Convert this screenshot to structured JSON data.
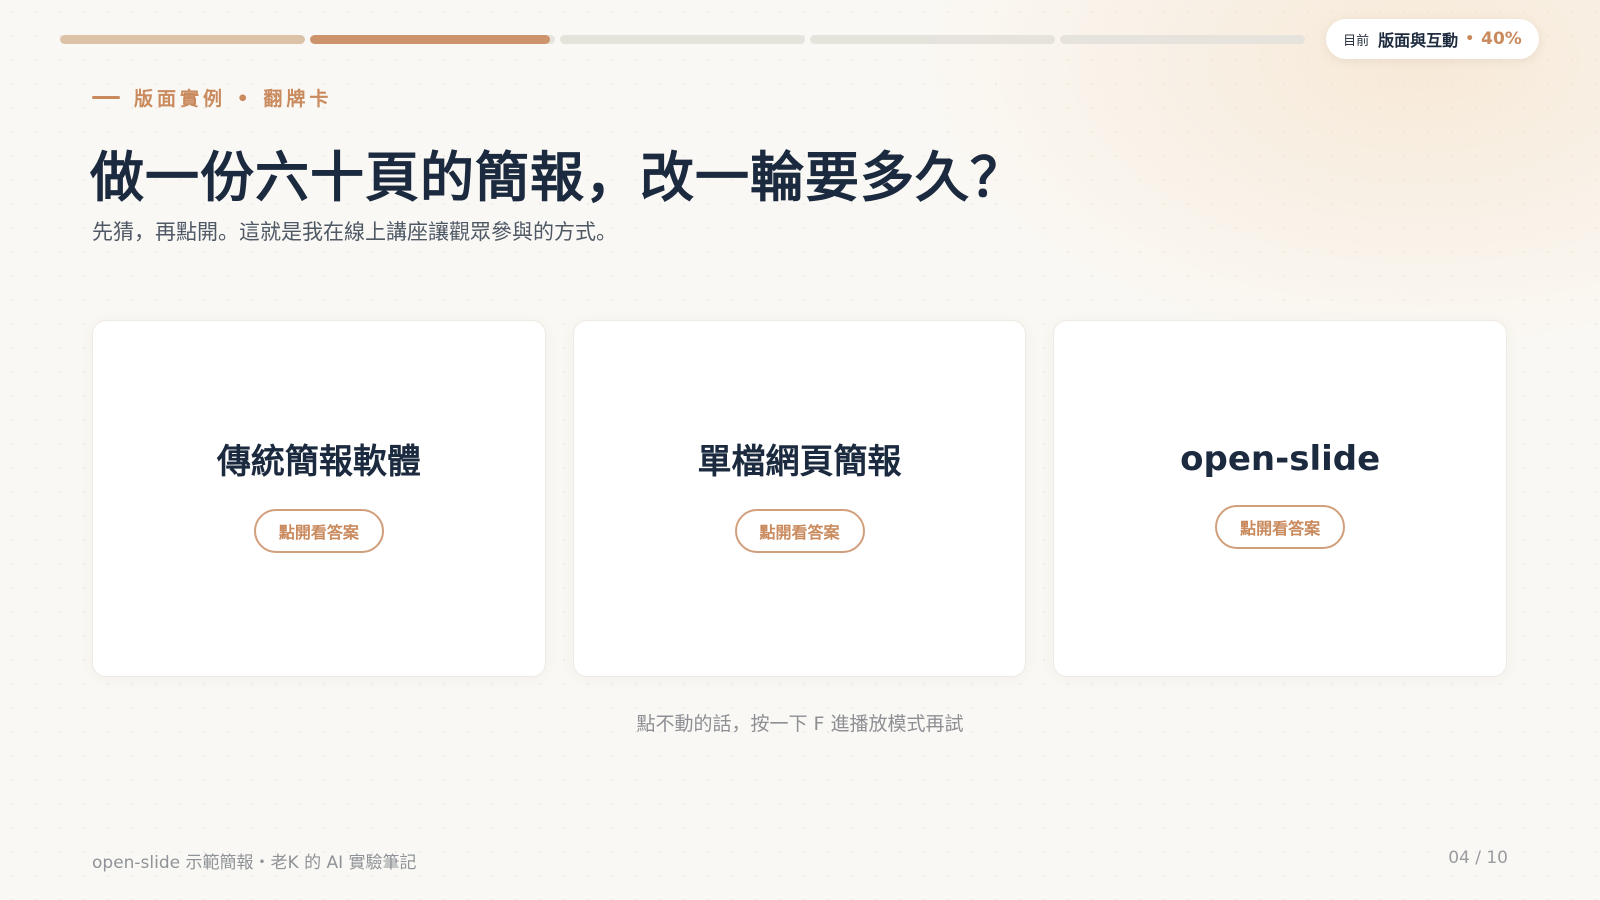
{
  "progress": {
    "segments": [
      {
        "state": "done",
        "fill": 1.0
      },
      {
        "state": "current",
        "fill": 0.98
      },
      {
        "state": "upcoming",
        "fill": 0
      },
      {
        "state": "upcoming",
        "fill": 0
      },
      {
        "state": "upcoming",
        "fill": 0
      }
    ]
  },
  "section_pill": {
    "label": "目前",
    "section": "版面與互動",
    "dot": "•",
    "percent": "40%"
  },
  "eyebrow": "版面實例 • 翻牌卡",
  "title": "做一份六十頁的簡報，改一輪要多久？",
  "subtitle": "先猜，再點開。這就是我在線上講座讓觀眾參與的方式。",
  "cards": [
    {
      "title": "傳統簡報軟體",
      "button": "點開看答案"
    },
    {
      "title": "單檔網頁簡報",
      "button": "點開看答案"
    },
    {
      "title": "open-slide",
      "button": "點開看答案"
    }
  ],
  "hint": "點不動的話，按一下 F 進播放模式再試",
  "footer": {
    "left": "open-slide 示範簡報・老K 的 AI 實驗筆記",
    "page": "04 / 10"
  },
  "colors": {
    "accent": "#c98a5e",
    "title": "#1b2a3e",
    "done_segment": "#dcc2a6",
    "current_segment": "#cd946c",
    "track": "#e6e2dc"
  }
}
